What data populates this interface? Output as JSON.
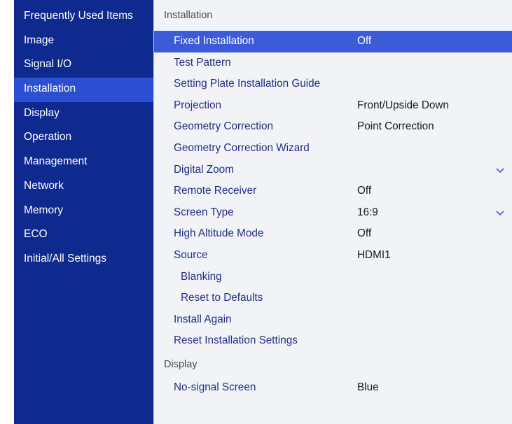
{
  "sidebar": {
    "items": [
      {
        "label": "Frequently Used Items"
      },
      {
        "label": "Image"
      },
      {
        "label": "Signal I/O"
      },
      {
        "label": "Installation"
      },
      {
        "label": "Display"
      },
      {
        "label": "Operation"
      },
      {
        "label": "Management"
      },
      {
        "label": "Network"
      },
      {
        "label": "Memory"
      },
      {
        "label": "ECO"
      },
      {
        "label": "Initial/All Settings"
      }
    ],
    "active_index": 3
  },
  "sections": [
    {
      "header": "Installation",
      "rows": [
        {
          "label": "Fixed Installation",
          "value": "Off"
        },
        {
          "label": "Test Pattern",
          "value": ""
        },
        {
          "label": "Setting Plate Installation Guide",
          "value": ""
        },
        {
          "label": "Projection",
          "value": "Front/Upside Down"
        },
        {
          "label": "Geometry Correction",
          "value": "Point Correction"
        },
        {
          "label": "Geometry Correction Wizard",
          "value": ""
        },
        {
          "label": "Digital Zoom",
          "value": "",
          "icon": "chevron-down-icon"
        },
        {
          "label": "Remote Receiver",
          "value": "Off"
        },
        {
          "label": "Screen Type",
          "value": "16:9",
          "icon": "chevron-down-icon"
        },
        {
          "label": "High Altitude Mode",
          "value": "Off"
        },
        {
          "label": "Source",
          "value": "HDMI1"
        },
        {
          "label": "Blanking",
          "value": ""
        },
        {
          "label": "Reset to Defaults",
          "value": ""
        },
        {
          "label": "Install Again",
          "value": ""
        },
        {
          "label": "Reset Installation Settings",
          "value": ""
        }
      ]
    },
    {
      "header": "Display",
      "rows": [
        {
          "label": "No-signal Screen",
          "value": "Blue"
        }
      ]
    }
  ],
  "colors": {
    "sidebar_bg": "#0f2a8f",
    "sidebar_active": "#2c4fd1",
    "row_selected": "#3b5bd7",
    "row_text": "#1f2f86"
  }
}
